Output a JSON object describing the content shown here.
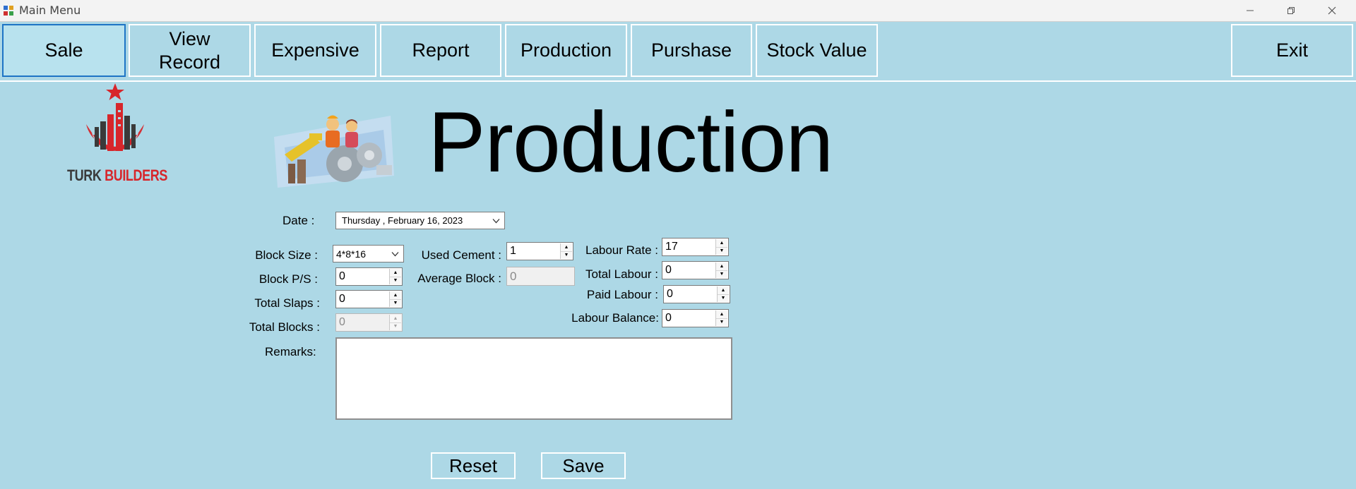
{
  "window": {
    "title": "Main Menu",
    "icon": "app-grid-icon",
    "controls": [
      "minimize-icon",
      "restore-icon",
      "close-icon"
    ]
  },
  "toolbar": {
    "sale": "Sale",
    "view_record_line1": "View",
    "view_record_line2": "Record",
    "expensive": "Expensive",
    "report": "Report",
    "production": "Production",
    "purshase": "Purshase",
    "stock_value": "Stock Value",
    "exit": "Exit"
  },
  "header": {
    "logo_text_1": "TURK",
    "logo_text_2": "BUILDERS",
    "heading": "Production",
    "hero_image": "production-workers-image"
  },
  "form": {
    "date_label": "Date :",
    "date_value": "Thursday  ,  February  16, 2023",
    "block_size_label": "Block Size :",
    "block_size_value": "4*8*16",
    "block_ps_label": "Block P/S :",
    "block_ps_value": "0",
    "total_slaps_label": "Total Slaps :",
    "total_slaps_value": "0",
    "total_blocks_label": "Total Blocks :",
    "total_blocks_value": "0",
    "used_cement_label": "Used Cement :",
    "used_cement_value": "1",
    "average_block_label": "Average Block :",
    "average_block_value": "0",
    "labour_rate_label": "Labour Rate :",
    "labour_rate_value": "17",
    "total_labour_label": "Total Labour :",
    "total_labour_value": "0",
    "paid_labour_label": "Paid Labour :",
    "paid_labour_value": "0",
    "labour_balance_label": "Labour Balance:",
    "labour_balance_value": "0",
    "remarks_label": "Remarks:",
    "remarks_value": ""
  },
  "actions": {
    "reset": "Reset",
    "save": "Save"
  },
  "colors": {
    "background": "#add8e6",
    "active_border": "#1e74c5",
    "logo_red": "#d7262b",
    "logo_dark": "#3a3a3a"
  }
}
